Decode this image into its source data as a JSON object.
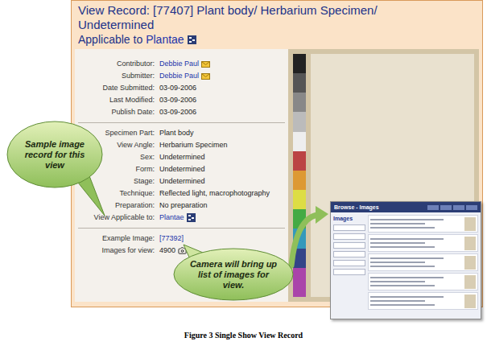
{
  "record": {
    "title": "View Record: [77407] Plant body/ Herbarium Specimen/ Undetermined",
    "applicable_label": "Applicable to",
    "applicable_link": "Plantae"
  },
  "field_groups": [
    {
      "fields": [
        {
          "label": "Contributor:",
          "value": "Debbie Paul",
          "kind": "email"
        },
        {
          "label": "Submitter:",
          "value": "Debbie Paul",
          "kind": "email"
        },
        {
          "label": "Date Submitted:",
          "value": "03-09-2006",
          "kind": "text"
        },
        {
          "label": "Last Modified:",
          "value": "03-09-2006",
          "kind": "text"
        },
        {
          "label": "Publish Date:",
          "value": "03-09-2006",
          "kind": "text"
        }
      ]
    },
    {
      "fields": [
        {
          "label": "Specimen Part:",
          "value": "Plant body",
          "kind": "text"
        },
        {
          "label": "View Angle:",
          "value": "Herbarium Specimen",
          "kind": "text"
        },
        {
          "label": "Sex:",
          "value": "Undetermined",
          "kind": "text"
        },
        {
          "label": "Form:",
          "value": "Undetermined",
          "kind": "text"
        },
        {
          "label": "Stage:",
          "value": "Undetermined",
          "kind": "text"
        },
        {
          "label": "Technique:",
          "value": "Reflected light, macrophotography",
          "kind": "text"
        },
        {
          "label": "Preparation:",
          "value": "No preparation",
          "kind": "text"
        },
        {
          "label": "View Applicable to:",
          "value": "Plantae",
          "kind": "taxon"
        }
      ]
    },
    {
      "fields": [
        {
          "label": "Example Image:",
          "value": "[77392]",
          "kind": "link"
        },
        {
          "label": "Images for view:",
          "value": "4900",
          "kind": "camera"
        }
      ]
    }
  ],
  "callouts": [
    {
      "text": "Sample image record for this view"
    },
    {
      "text": "Camera will bring up list of images for view."
    }
  ],
  "inset": {
    "title": "Browse - Images",
    "panel": "Images"
  },
  "caption": "Figure 3 Single Show View Record"
}
